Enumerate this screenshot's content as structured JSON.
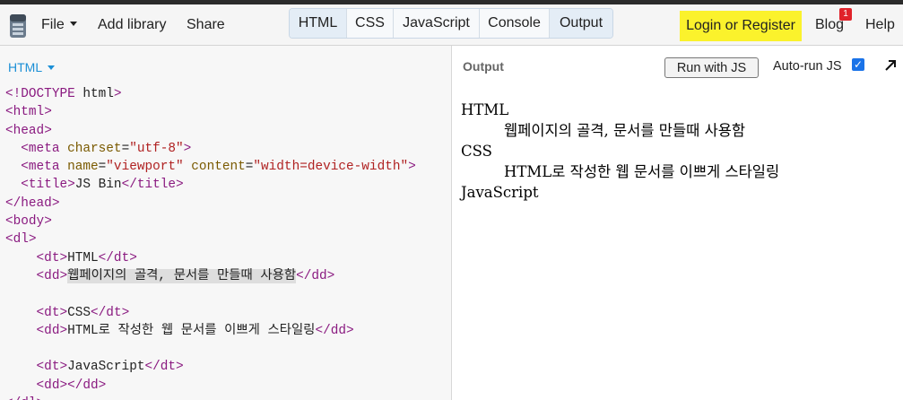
{
  "toolbar": {
    "menu": {
      "file": "File",
      "add_library": "Add library",
      "share": "Share"
    },
    "panels": [
      "HTML",
      "CSS",
      "JavaScript",
      "Console",
      "Output"
    ],
    "active_panels": [
      "HTML",
      "Output"
    ],
    "login": "Login or Register",
    "blog": "Blog",
    "blog_badge": "1",
    "help": "Help",
    "colors": {
      "login_bg": "#fbf22c",
      "badge_bg": "#e0222a",
      "accent": "#1b8fd6"
    }
  },
  "editor": {
    "panel_label": "HTML",
    "lines": [
      "<!DOCTYPE html>",
      "<html>",
      "<head>",
      "  <meta charset=\"utf-8\">",
      "  <meta name=\"viewport\" content=\"width=device-width\">",
      "  <title>JS Bin</title>",
      "</head>",
      "<body>",
      "<dl>",
      "    <dt>HTML</dt>",
      "    <dd>웹페이지의 골격, 문서를 만들때 사용함</dd>",
      "",
      "    <dt>CSS</dt>",
      "    <dd>HTML로 작성한 웹 문서를 이쁘게 스타일링</dd>",
      "",
      "    <dt>JavaScript</dt>",
      "    <dd></dd>",
      "</dl>"
    ],
    "selected_text": "웹페이지의 골격, 문서를 만들때 사용함"
  },
  "output": {
    "label": "Output",
    "run_button": "Run with JS",
    "autorun_label": "Auto-run JS",
    "autorun_checked": true,
    "expand_icon": "expand-arrow-icon",
    "items": [
      {
        "term": "HTML",
        "desc": "웹페이지의 골격, 문서를 만들때 사용함"
      },
      {
        "term": "CSS",
        "desc": "HTML로 작성한 웹 문서를 이쁘게 스타일링"
      },
      {
        "term": "JavaScript",
        "desc": ""
      }
    ]
  }
}
